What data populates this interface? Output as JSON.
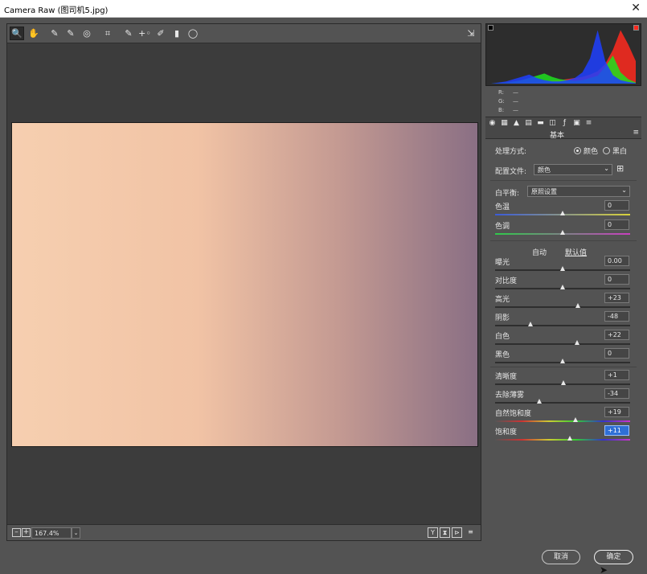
{
  "window": {
    "title": "Camera Raw (图司机5.jpg)",
    "close_glyph": "✕"
  },
  "toolbar": {
    "tools": [
      {
        "name": "zoom-tool",
        "glyph": "🔍"
      },
      {
        "name": "hand-tool",
        "glyph": "✋"
      },
      {
        "name": "white-balance-tool",
        "glyph": "✎"
      },
      {
        "name": "color-sampler-tool",
        "glyph": "✎"
      },
      {
        "name": "targeted-adjustment-tool",
        "glyph": "◎"
      },
      {
        "name": "crop-tool",
        "glyph": "⌗"
      },
      {
        "name": "spot-removal-tool",
        "glyph": "✎"
      },
      {
        "name": "red-eye-tool",
        "glyph": "+◦"
      },
      {
        "name": "adjustment-brush-tool",
        "glyph": "✐"
      },
      {
        "name": "graduated-filter-tool",
        "glyph": "▮"
      },
      {
        "name": "radial-filter-tool",
        "glyph": "◯"
      }
    ],
    "export_glyph": "⇲"
  },
  "status": {
    "zoom": "167.4%",
    "zoom_out": "–",
    "zoom_in": "+",
    "view_buttons": [
      "Y",
      "⧗",
      "⊳"
    ],
    "settings_glyph": "≡"
  },
  "histogram": {
    "labels": [
      "R:",
      "G:",
      "B:"
    ],
    "values": [
      "—",
      "—",
      "—"
    ]
  },
  "panel": {
    "title": "基本",
    "menu_glyph": "≡",
    "process_label": "处理方式:",
    "process_options": [
      "颜色",
      "黑白"
    ],
    "profile_label": "配置文件:",
    "profile_value": "颜色",
    "wb_label": "白平衡:",
    "wb_value": "原照设置",
    "auto_label": "自动",
    "default_label": "默认值",
    "sliders": [
      {
        "label": "色温",
        "value": "0",
        "level": 0.5
      },
      {
        "label": "色调",
        "value": "0",
        "level": 0.5
      },
      {
        "label": "曝光",
        "value": "0.00",
        "level": 0.5
      },
      {
        "label": "对比度",
        "value": "0",
        "level": 0.5
      },
      {
        "label": "高光",
        "value": "+23",
        "level": 0.615
      },
      {
        "label": "阴影",
        "value": "-48",
        "level": 0.26
      },
      {
        "label": "白色",
        "value": "+22",
        "level": 0.61
      },
      {
        "label": "黑色",
        "value": "0",
        "level": 0.5
      },
      {
        "label": "清晰度",
        "value": "+1",
        "level": 0.505
      },
      {
        "label": "去除薄雾",
        "value": "-34",
        "level": 0.33
      },
      {
        "label": "自然饱和度",
        "value": "+19",
        "level": 0.595
      },
      {
        "label": "饱和度",
        "value": "+11",
        "level": 0.555
      }
    ]
  },
  "buttons": {
    "cancel": "取消",
    "ok": "确定"
  },
  "chart_data": {
    "type": "area",
    "series": [
      {
        "color": "#ff2a1f",
        "values": [
          0,
          0,
          1,
          1,
          2,
          2,
          3,
          4,
          5,
          6,
          8,
          10,
          12,
          16,
          22,
          35,
          60,
          95,
          70,
          40
        ]
      },
      {
        "color": "#1fe01f",
        "values": [
          0,
          1,
          2,
          4,
          6,
          10,
          14,
          18,
          12,
          8,
          6,
          5,
          6,
          10,
          14,
          30,
          50,
          20,
          8,
          2
        ]
      },
      {
        "color": "#1f3fff",
        "values": [
          0,
          2,
          4,
          8,
          12,
          16,
          10,
          6,
          4,
          4,
          6,
          10,
          20,
          45,
          95,
          40,
          15,
          6,
          3,
          1
        ]
      }
    ],
    "ylim": [
      0,
      100
    ],
    "grid": false
  }
}
